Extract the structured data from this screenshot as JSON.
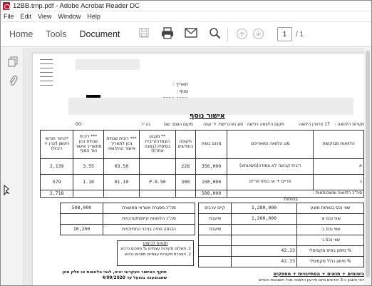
{
  "window": {
    "title": "12BB.tmp.pdf - Adobe Acrobat Reader DC"
  },
  "menu": [
    "File",
    "Edit",
    "View",
    "Window",
    "Help"
  ],
  "nav_tabs": [
    "Home",
    "Tools",
    "Document"
  ],
  "toolbar": {
    "page_current": "1",
    "page_total": "/ 1"
  },
  "document": {
    "header_fields": [
      "תאריך :",
      "סניף :",
      "מספר כיתבת :"
    ],
    "heading": "אישור נוסף",
    "subheader": {
      "ref_number": "00:",
      "period": "גה יר",
      "col_a": "מקום הוצס: שם",
      "col_b": "סוג חהכרישת: יר עגיה",
      "col_c": "מקום הלוואה רכישה",
      "col_d": "17 פרוורן הלואה",
      "col_e": "מטרות הלוואה :"
    },
    "main_table": {
      "headers": [
        "הלוואות מבוקשות",
        "סוג הלוואה ומאפיינים",
        "סכום בשיח",
        "תקופה בחודשים",
        "** מנגנון הצמדה/ריבית בסיסית (במנה אחרת)",
        "*** ריבית שנתית נכון לתאריך אישור ההלוואה",
        "*** ריבית שנתית נכון מתאריך אישור ועד הסוף",
        "*החזר חודשי ראשון (קרן + ריבית)"
      ],
      "rows": [
        [
          "א",
          "ריבית קבועה לא צמודה(משכנתא)",
          "356,000",
          "228",
          "",
          "03.50",
          "3.55",
          "2,139"
        ],
        [
          "ב",
          "פריים + או בסיס פריים",
          "150,000",
          "300",
          "P-0.50",
          "01.10",
          "1.10",
          "579"
        ]
      ],
      "total_label": "סה\"כ הלוואה ומשכנתאות :",
      "total_amount": "508,000",
      "total_monthly": "2,718"
    },
    "left_table": {
      "rows": [
        [
          "סה\"כ מסגרת אשראי מאושרת",
          "508,000"
        ],
        [
          "סה\"כ הלוואות קיימות/ערבויות",
          ""
        ],
        [
          "הכנסה פנויה בניכוי התחייבויות",
          "10,200"
        ]
      ]
    },
    "right_table": {
      "title": "בטוחות",
      "rows": [
        [
          "שווי נכס בטוחות מוצע",
          "1,280,000",
          "קיים ערבים"
        ],
        [
          "שווי נכס א׳",
          "1,200,000",
          "שיעבוד"
        ],
        [
          "שווי נכס ב׳",
          "",
          "שיעבוד"
        ],
        [
          "שווי נכס ג׳",
          "",
          ""
        ],
        [
          "% מימון בסיס מקסימלי",
          "42.33",
          ""
        ],
        [
          "% מימון כולל מקסימלי",
          "42.33",
          ""
        ]
      ]
    },
    "conditions": {
      "title": "תנאים לביצוע",
      "items": [
        "1. תשלום מקורות עצמיים % מסכום נרכש.",
        "2. הצהרת מקורות עצמיים מסכום נרכש."
      ]
    },
    "footer_left": "תוקף האישור העקרוני יהיה, לגבי הלוואות או חלק מהן שתבוצענה בפועל עד 4/09/2020",
    "footer_right": "ביטוחים + תנאים + הסתייגויות + מספקים",
    "footer_right_sub": "דמי חשבון כ-3 חודשים מיום פירעון הלוואה מכל חשבונות הוסיים"
  }
}
